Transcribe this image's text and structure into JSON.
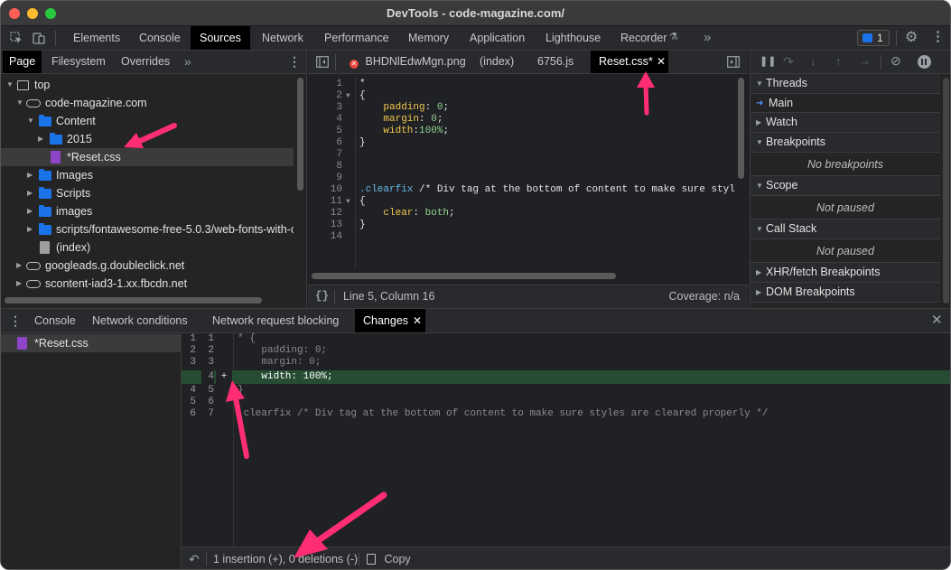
{
  "window": {
    "title": "DevTools - code-magazine.com/"
  },
  "colors": {
    "red": "#ff5f57",
    "yellow": "#febc2e",
    "green": "#28c840",
    "accent": "#1a73e8",
    "pink_arrow": "#ff2d74"
  },
  "toolbar": {
    "tabs": [
      "Elements",
      "Console",
      "Sources",
      "Network",
      "Performance",
      "Memory",
      "Application",
      "Lighthouse",
      "Recorder"
    ],
    "active": "Sources",
    "issues_count": "1",
    "more": "»"
  },
  "navigator": {
    "tabs": [
      "Page",
      "Filesystem",
      "Overrides"
    ],
    "more": "»",
    "tree": [
      {
        "label": "top",
        "icon": "frame-icon"
      },
      {
        "label": "code-magazine.com",
        "icon": "cloud-icon"
      },
      {
        "label": "Content",
        "icon": "folder-icon"
      },
      {
        "label": "2015",
        "icon": "folder-icon"
      },
      {
        "label": "*Reset.css",
        "icon": "css-file-icon"
      },
      {
        "label": "Images",
        "icon": "folder-icon"
      },
      {
        "label": "Scripts",
        "icon": "folder-icon"
      },
      {
        "label": "images",
        "icon": "folder-icon"
      },
      {
        "label": "scripts/fontawesome-free-5.0.3/web-fonts-with-c",
        "icon": "folder-icon"
      },
      {
        "label": "(index)",
        "icon": "file-icon"
      },
      {
        "label": "googleads.g.doubleclick.net",
        "icon": "cloud-icon"
      },
      {
        "label": "scontent-iad3-1.xx.fbcdn.net",
        "icon": "cloud-icon"
      }
    ]
  },
  "editor": {
    "tabs": [
      "BHDNlEdwMgn.png",
      "(index)",
      "6756.js",
      "Reset.css*"
    ],
    "lines": [
      {
        "n": "1",
        "t": "*"
      },
      {
        "n": "2",
        "t": "{"
      },
      {
        "n": "3",
        "t": "    padding: 0;"
      },
      {
        "n": "4",
        "t": "    margin: 0;"
      },
      {
        "n": "5",
        "t": "    width:100%;"
      },
      {
        "n": "6",
        "t": "}"
      },
      {
        "n": "7",
        "t": ""
      },
      {
        "n": "8",
        "t": ""
      },
      {
        "n": "9",
        "t": ""
      },
      {
        "n": "10",
        "t": ".clearfix /* Div tag at the bottom of content to make sure styl"
      },
      {
        "n": "11",
        "t": "{"
      },
      {
        "n": "12",
        "t": "    clear: both;"
      },
      {
        "n": "13",
        "t": "}"
      },
      {
        "n": "14",
        "t": ""
      }
    ],
    "status": {
      "format_icon": "{}",
      "position": "Line 5, Column 16",
      "coverage": "Coverage: n/a"
    }
  },
  "debugger": {
    "sections": {
      "threads": "Threads",
      "main": "Main",
      "watch": "Watch",
      "breakpoints": "Breakpoints",
      "no_breakpoints": "No breakpoints",
      "scope": "Scope",
      "scope_status": "Not paused",
      "callstack": "Call Stack",
      "callstack_status": "Not paused",
      "xhr": "XHR/fetch Breakpoints",
      "dom": "DOM Breakpoints"
    }
  },
  "drawer": {
    "tabs": [
      "Console",
      "Network conditions",
      "Network request blocking",
      "Changes"
    ],
    "active": "Changes",
    "file": "*Reset.css",
    "diff": [
      {
        "a": "1",
        "b": "1",
        "t": "* {",
        "type": "ctx"
      },
      {
        "a": "2",
        "b": "2",
        "t": "    padding: 0;",
        "type": "ctx"
      },
      {
        "a": "3",
        "b": "3",
        "t": "    margin: 0;",
        "type": "ctx"
      },
      {
        "a": "",
        "b": "4",
        "t": "    width: 100%;",
        "type": "add",
        "mark": "+"
      },
      {
        "a": "4",
        "b": "5",
        "t": "}",
        "type": "ctx"
      },
      {
        "a": "5",
        "b": "6",
        "t": "",
        "type": "ctx"
      },
      {
        "a": "6",
        "b": "7",
        "t": ".clearfix /* Div tag at the bottom of content to make sure styles are cleared properly */",
        "type": "ctx"
      }
    ],
    "summary": "1 insertion (+), 0 deletions (-)",
    "copy": "Copy"
  }
}
